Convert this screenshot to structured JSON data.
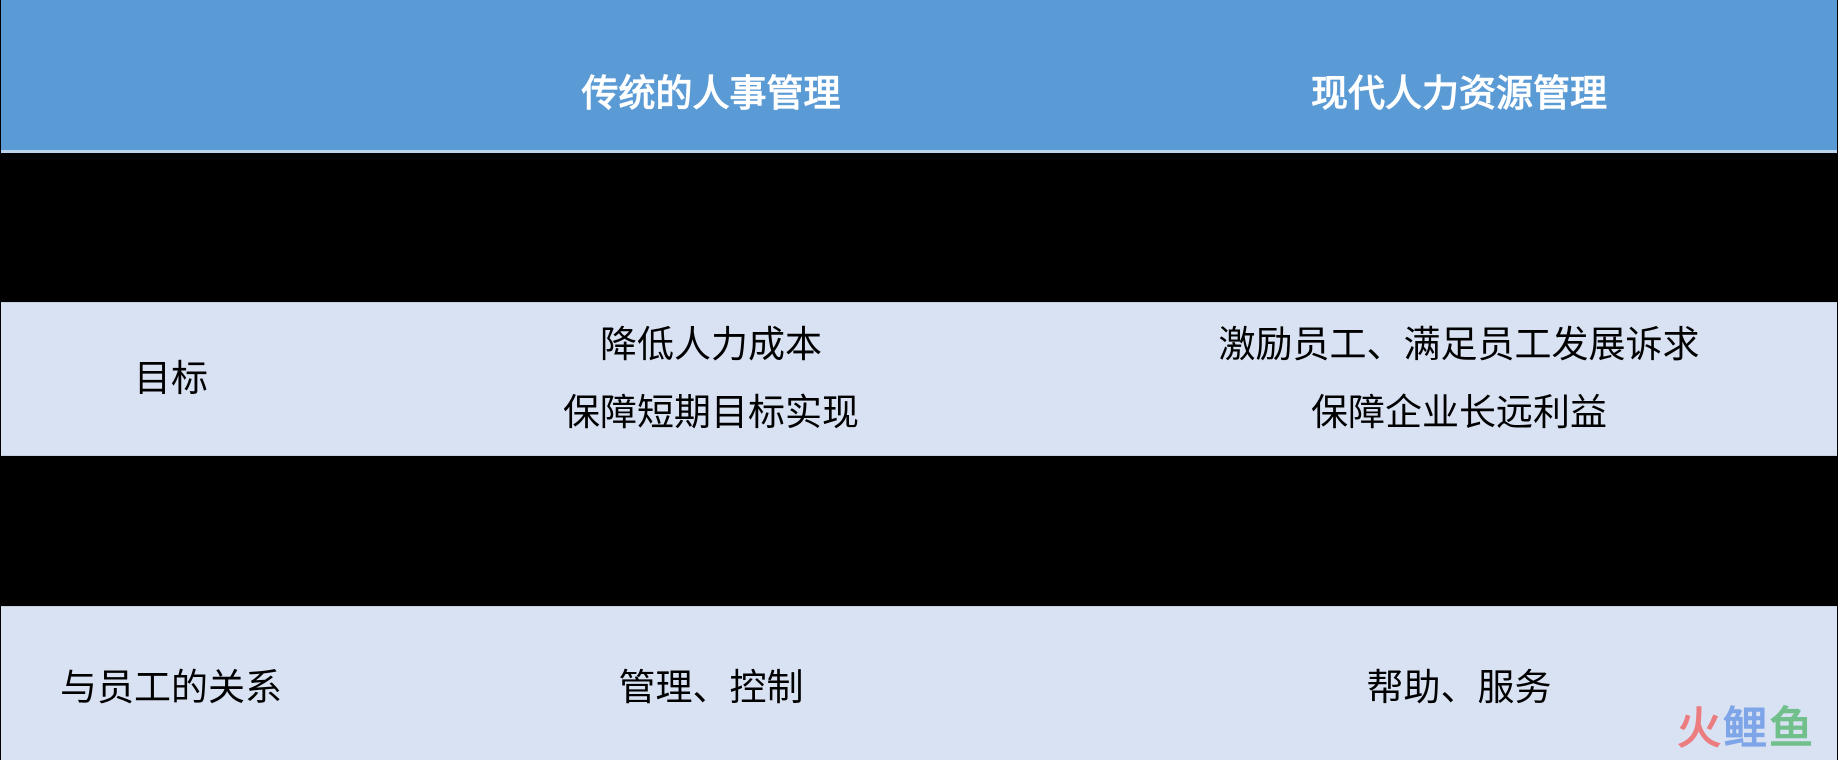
{
  "table": {
    "header": {
      "col0": "",
      "col1": "传统的人事管理",
      "col2": "现代人力资源管理"
    },
    "rows": [
      {
        "label": "",
        "traditional": [],
        "modern": [],
        "redacted": true
      },
      {
        "label": "目标",
        "traditional": [
          "降低人力成本",
          "保障短期目标实现"
        ],
        "modern": [
          "激励员工、满足员工发展诉求",
          "保障企业长远利益"
        ],
        "redacted": false
      },
      {
        "label": "",
        "traditional": [],
        "modern": [],
        "redacted": true
      },
      {
        "label": "与员工的关系",
        "traditional": [
          "管理、控制"
        ],
        "modern": [
          "帮助、服务"
        ],
        "redacted": false
      }
    ]
  },
  "colors": {
    "header_bg": "#5b9bd5",
    "row_light_bg": "#d9e2f3",
    "redacted_bg": "#000000",
    "header_text": "#ffffff"
  },
  "watermark": {
    "chars": [
      "火",
      "鲤",
      "鱼"
    ],
    "colors": [
      "#ef6b6b",
      "#6f9be6",
      "#5fb97a"
    ]
  }
}
